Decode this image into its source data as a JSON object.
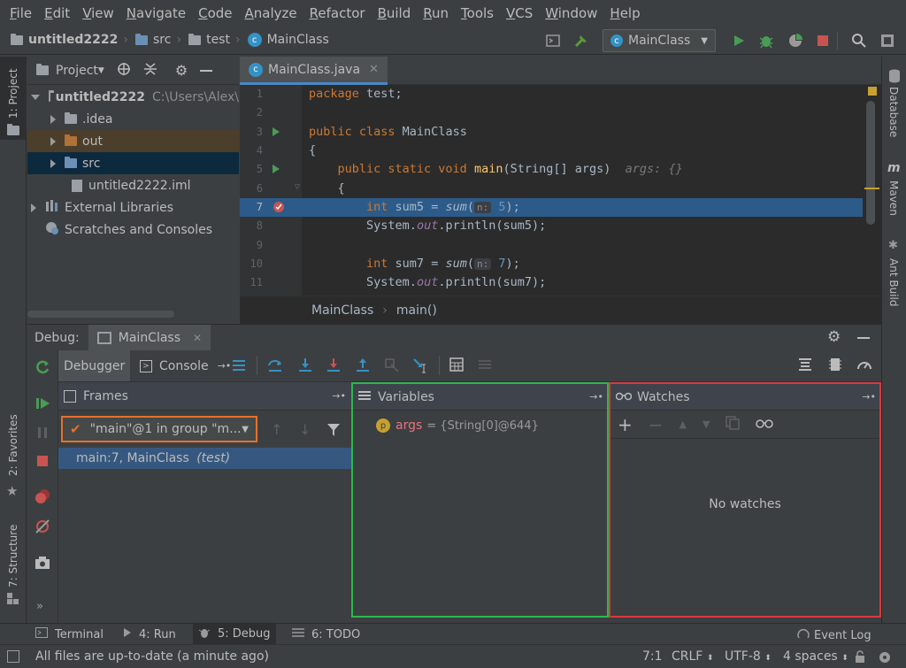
{
  "menu": [
    "File",
    "Edit",
    "View",
    "Navigate",
    "Code",
    "Analyze",
    "Refactor",
    "Build",
    "Run",
    "Tools",
    "VCS",
    "Window",
    "Help"
  ],
  "navbar": {
    "crumbs": [
      "untitled2222",
      "src",
      "test",
      "MainClass"
    ],
    "run_config": "MainClass"
  },
  "left_strip": {
    "project": "1: Project",
    "favorites": "2: Favorites",
    "structure": "7: Structure"
  },
  "right_strip": {
    "database": "Database",
    "maven": "Maven",
    "ant": "Ant Build"
  },
  "project": {
    "view_label": "Project",
    "tree": [
      {
        "label": "untitled2222",
        "extra": "C:\\Users\\Alex\\"
      },
      {
        "label": ".idea"
      },
      {
        "label": "out"
      },
      {
        "label": "src"
      },
      {
        "label": "untitled2222.iml"
      },
      {
        "label": "External Libraries"
      },
      {
        "label": "Scratches and Consoles"
      }
    ]
  },
  "editor": {
    "tab": "MainClass.java",
    "line_numbers": [
      "1",
      "2",
      "3",
      "4",
      "5",
      "6",
      "7",
      "8",
      "9",
      "10",
      "11"
    ],
    "breadcrumb": [
      "MainClass",
      "main()"
    ]
  },
  "code": {
    "l1_kw": "package",
    "l1_rest": " test;",
    "l3_kw": "public class",
    "l3_rest": " MainClass",
    "l4": "{",
    "l5_kw": "public static void",
    "l5_fn": "main",
    "l5_rest": "(String[] args)",
    "l5_hint": "args: {}",
    "l6": "{",
    "l7_kw": "int",
    "l7_var": " sum5 = ",
    "l7_fn": "sum",
    "l7_hint": "n:",
    "l7_num": "5",
    "l7_end": ");",
    "l8_a": "System.",
    "l8_static": "out",
    "l8_b": ".println(sum5);",
    "l10_kw": "int",
    "l10_var": " sum7 = ",
    "l10_fn": "sum",
    "l10_hint": "n:",
    "l10_num": "7",
    "l10_end": ");",
    "l11_a": "System.",
    "l11_static": "out",
    "l11_b": ".println(sum7);"
  },
  "debug": {
    "label": "Debug:",
    "session": "MainClass",
    "tabs": {
      "debugger": "Debugger",
      "console": "Console"
    },
    "frames": {
      "title": "Frames",
      "thread": "\"main\"@1 in group \"m...",
      "frame": "main:7, MainClass",
      "frame_pkg": "(test)"
    },
    "variables": {
      "title": "Variables",
      "items": [
        {
          "name": "args",
          "value": "= {String[0]@644}"
        }
      ]
    },
    "watches": {
      "title": "Watches",
      "empty": "No watches"
    }
  },
  "toolwindows": [
    "Terminal",
    "4: Run",
    "5: Debug",
    "6: TODO"
  ],
  "event_log": "Event Log",
  "status": {
    "message": "All files are up-to-date (a minute ago)",
    "position": "7:1",
    "line_sep": "CRLF",
    "encoding": "UTF-8",
    "indent": "4 spaces"
  }
}
